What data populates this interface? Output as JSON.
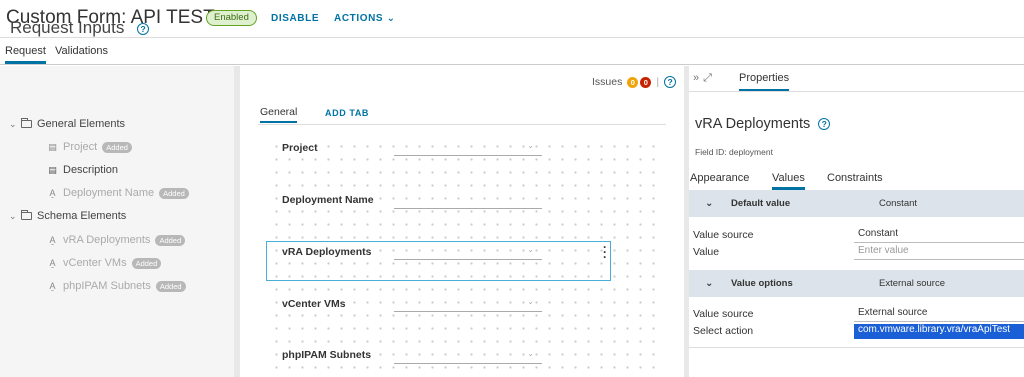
{
  "header": {
    "title": "Custom Form: API TEST",
    "status_badge": "Enabled",
    "disable_label": "DISABLE",
    "actions_label": "ACTIONS ⌄"
  },
  "subtabs": {
    "request": "Request",
    "validations": "Validations"
  },
  "left_panel": {
    "title": "Request Inputs",
    "groups": [
      {
        "label": "General Elements",
        "items": [
          {
            "label": "Project",
            "badge": "Added",
            "icon": "form-field-icon"
          },
          {
            "label": "Description",
            "badge": "",
            "icon": "textarea-icon"
          },
          {
            "label": "Deployment Name",
            "badge": "Added",
            "icon": "text-field-icon"
          }
        ]
      },
      {
        "label": "Schema Elements",
        "items": [
          {
            "label": "vRA Deployments",
            "badge": "Added",
            "icon": "text-field-icon"
          },
          {
            "label": "vCenter VMs",
            "badge": "Added",
            "icon": "text-field-icon"
          },
          {
            "label": "phpIPAM Subnets",
            "badge": "Added",
            "icon": "text-field-icon"
          }
        ]
      }
    ]
  },
  "canvas": {
    "issues_label": "Issues",
    "issues_warnings": "0",
    "issues_errors": "0",
    "tab_general": "General",
    "add_tab": "ADD TAB",
    "fields": [
      "Project",
      "Deployment Name",
      "vRA Deployments",
      "vCenter VMs",
      "phpIPAM Subnets"
    ]
  },
  "properties": {
    "tab_label": "Properties",
    "title": "vRA Deployments",
    "field_id": "Field ID: deployment",
    "tabs": [
      "Appearance",
      "Values",
      "Constraints"
    ],
    "default_value": {
      "header": "Default value",
      "summary": "Constant",
      "value_source_label": "Value source",
      "value_source": "Constant",
      "value_label": "Value",
      "value_placeholder": "Enter value"
    },
    "value_options": {
      "header": "Value options",
      "summary": "External source",
      "value_source_label": "Value source",
      "value_source": "External source",
      "select_action_label": "Select action",
      "select_action": "com.vmware.library.vra/vraApiTest"
    }
  },
  "colors": {
    "accent": "#0072a3",
    "selection": "#49afd9",
    "highlight": "#1a5fd6",
    "warning": "#efa40a",
    "error": "#c92100"
  }
}
